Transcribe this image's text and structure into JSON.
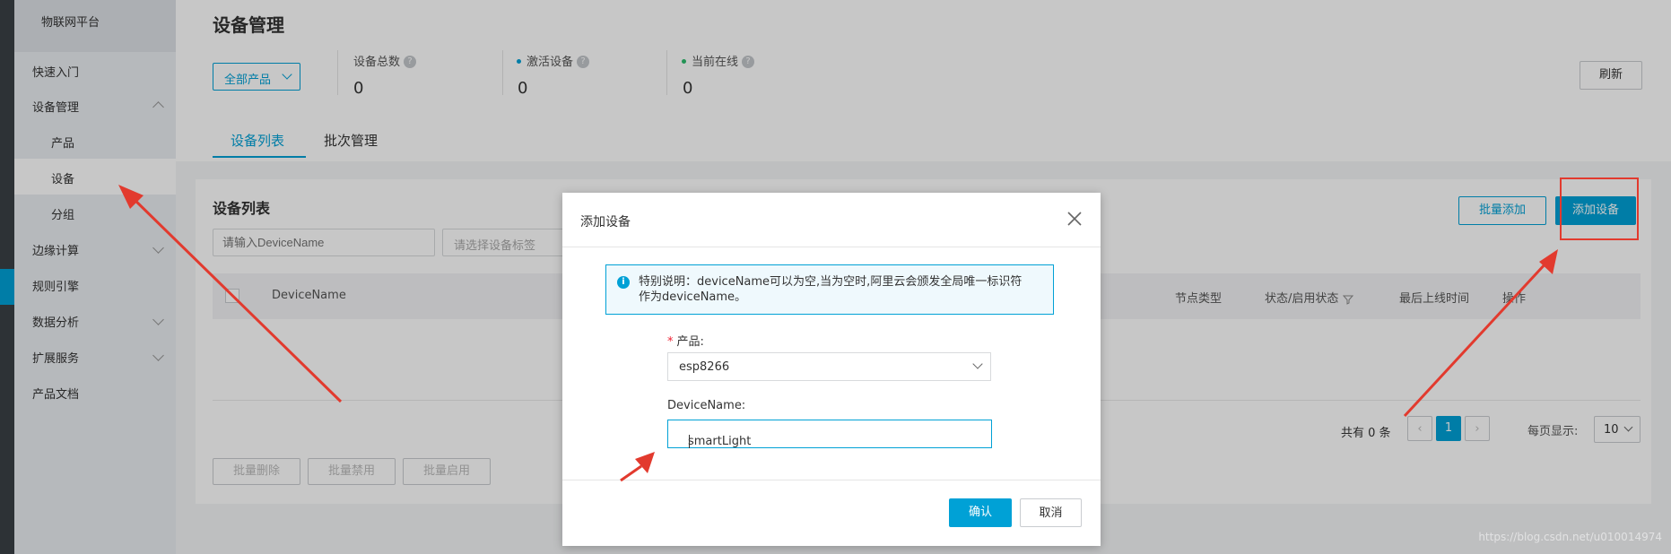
{
  "sidebar": {
    "brand": "物联网平台",
    "items": [
      {
        "label": "快速入门"
      },
      {
        "label": "设备管理"
      },
      {
        "label": "产品"
      },
      {
        "label": "设备"
      },
      {
        "label": "分组"
      },
      {
        "label": "边缘计算"
      },
      {
        "label": "规则引擎"
      },
      {
        "label": "数据分析"
      },
      {
        "label": "扩展服务"
      },
      {
        "label": "产品文档"
      }
    ]
  },
  "header": {
    "title": "设备管理",
    "product_filter": "全部产品",
    "stats": [
      {
        "label": "设备总数",
        "value": "0"
      },
      {
        "label": "激活设备",
        "value": "0",
        "color": "#00a1d6"
      },
      {
        "label": "当前在线",
        "value": "0",
        "color": "#2dbd6e"
      }
    ],
    "refresh_label": "刷新",
    "tabs": [
      {
        "label": "设备列表",
        "active": true
      },
      {
        "label": "批次管理",
        "active": false
      }
    ]
  },
  "device_list": {
    "title": "设备列表",
    "batch_add_label": "批量添加",
    "add_device_label": "添加设备",
    "search_placeholder": "请输入DeviceName",
    "tag_placeholder": "请选择设备标签",
    "columns": [
      "DeviceName",
      "节点类型",
      "状态/启用状态",
      "最后上线时间",
      "操作"
    ],
    "total_text": "共有 0 条",
    "current_page": "1",
    "page_size_label": "每页显示:",
    "page_size": "10",
    "bulk_actions": [
      "批量删除",
      "批量禁用",
      "批量启用"
    ]
  },
  "dialog": {
    "title": "添加设备",
    "notice": "特别说明：deviceName可以为空,当为空时,阿里云会颁发全局唯一标识符作为deviceName。",
    "product_label": "产品:",
    "product_required": "*",
    "product_value": "esp8266",
    "devicename_label": "DeviceName:",
    "devicename_value": "smartLight",
    "confirm_label": "确认",
    "cancel_label": "取消"
  },
  "watermark": "https://blog.csdn.net/u010014974"
}
